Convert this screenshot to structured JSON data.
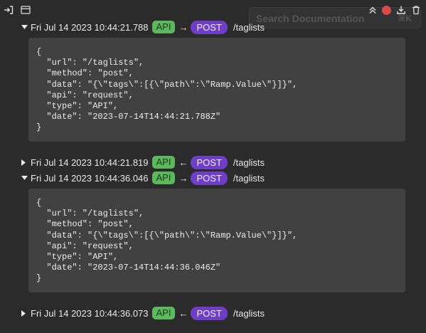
{
  "toolbar": {
    "left_icons": [
      "sign-in-icon",
      "panel-icon"
    ],
    "right_icons": [
      "collapse-all-icon",
      "record-icon",
      "download-icon",
      "trash-icon"
    ],
    "search_placeholder": "Search Documentation",
    "search_shortcut": "⌘K"
  },
  "colors": {
    "background": "#2b2b2b",
    "code_panel": "#414141",
    "api_badge": "#5cb85c",
    "post_badge": "#6f3ec7",
    "record": "#d94a4a"
  },
  "entries": [
    {
      "expanded": true,
      "timestamp": "Fri Jul 14 2023 10:44:21.788",
      "api_label": "API",
      "direction": "→",
      "method_label": "POST",
      "path": "/taglists",
      "body": "{\n  \"url\": \"/taglists\",\n  \"method\": \"post\",\n  \"data\": \"{\\\"tags\\\":[{\\\"path\\\":\\\"Ramp.Value\\\"}]}\",\n  \"api\": \"request\",\n  \"type\": \"API\",\n  \"date\": \"2023-07-14T14:44:21.788Z\"\n}"
    },
    {
      "expanded": false,
      "timestamp": "Fri Jul 14 2023 10:44:21.819",
      "api_label": "API",
      "direction": "←",
      "method_label": "POST",
      "path": "/taglists"
    },
    {
      "expanded": true,
      "timestamp": "Fri Jul 14 2023 10:44:36.046",
      "api_label": "API",
      "direction": "→",
      "method_label": "POST",
      "path": "/taglists",
      "body": "{\n  \"url\": \"/taglists\",\n  \"method\": \"post\",\n  \"data\": \"{\\\"tags\\\":[{\\\"path\\\":\\\"Ramp.Value\\\"}]}\",\n  \"api\": \"request\",\n  \"type\": \"API\",\n  \"date\": \"2023-07-14T14:44:36.046Z\"\n}"
    },
    {
      "expanded": false,
      "timestamp": "Fri Jul 14 2023 10:44:36.073",
      "api_label": "API",
      "direction": "←",
      "method_label": "POST",
      "path": "/taglists"
    }
  ]
}
